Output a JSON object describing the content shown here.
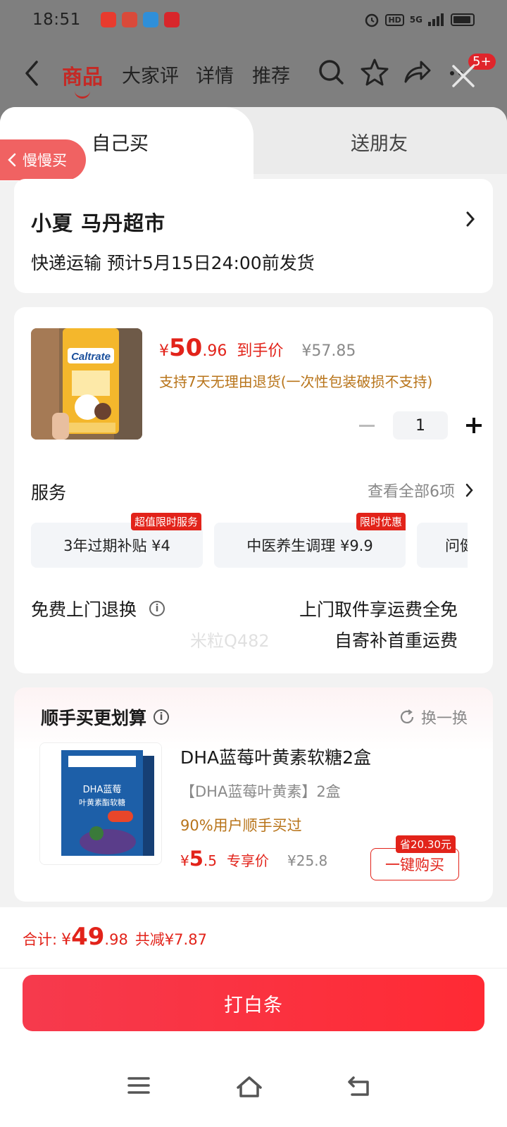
{
  "status_bar": {
    "time": "18:51",
    "network": "5G"
  },
  "top_nav": {
    "tabs": [
      "商品",
      "大家评",
      "详情",
      "推荐"
    ],
    "active_tab": "商品",
    "badge": "5+"
  },
  "sheet": {
    "tabs": {
      "self_buy": "自己买",
      "gift": "送朋友"
    },
    "slow_buy": "慢慢买",
    "address": {
      "name": "小夏  马丹超市",
      "shipping": "快递运输 预计5月15日24:00前发货"
    },
    "product": {
      "currency": "¥",
      "price_int": "50",
      "price_dec": ".96",
      "price_tag": "到手价",
      "original_price": "¥57.85",
      "return_policy": "支持7天无理由退货(一次性包装破损不支持)",
      "quantity": "1"
    },
    "services": {
      "title": "服务",
      "view_all": "查看全部6项",
      "chips": [
        {
          "label": "3年过期补贴  ¥4",
          "flag": "超值限时服务"
        },
        {
          "label": "中医养生调理  ¥9.9",
          "flag": "限时优惠"
        },
        {
          "label": "问健",
          "flag": ""
        }
      ]
    },
    "free_return": {
      "title": "免费上门退换",
      "line1": "上门取件享运费全免",
      "line2": "自寄补首重运费"
    },
    "recommend": {
      "title": "顺手买更划算",
      "swap": "换一换",
      "name": "DHA蓝莓叶黄素软糖2盒",
      "subtitle": "【DHA蓝莓叶黄素】2盒",
      "percent": "90%用户顺手买过",
      "currency": "¥",
      "price_int": "5",
      "price_dec": ".5",
      "price_tag": "专享价",
      "original_price": "¥25.8",
      "buy_button": "一键购买",
      "save_tag": "省20.30元"
    },
    "watermark": "米粒Q482"
  },
  "footer": {
    "total_label": "合计:",
    "currency": "¥",
    "total_int": "49",
    "total_dec": ".98",
    "discount": "共减¥7.87",
    "pay_button": "打白条"
  },
  "colors": {
    "accent": "#e2231a",
    "pay_button": "#ff2a34",
    "overlay": "#7f7f7f"
  }
}
